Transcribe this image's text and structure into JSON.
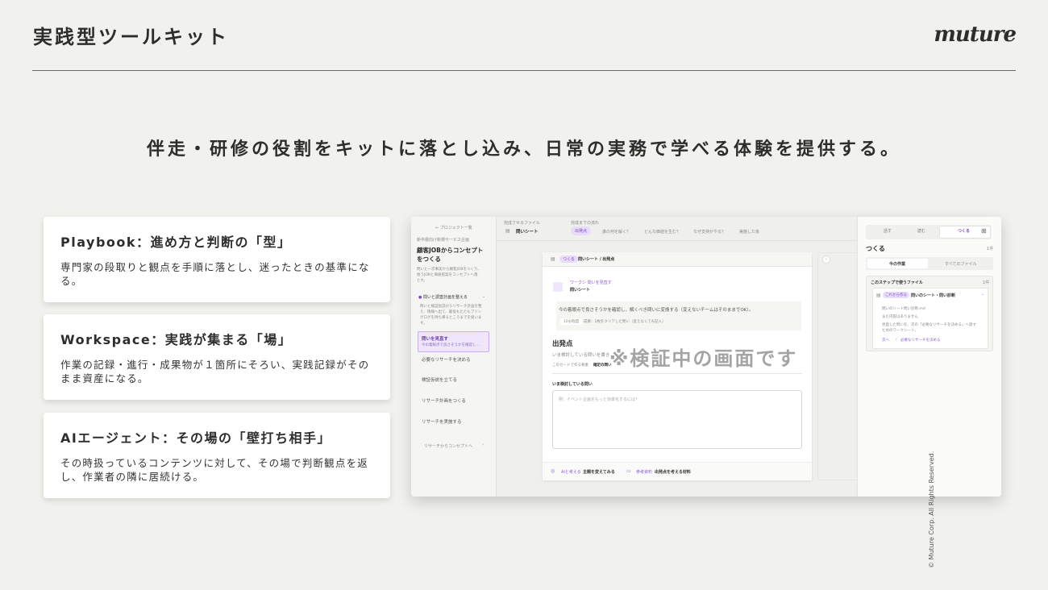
{
  "header": {
    "title": "実践型ツールキット",
    "logo_text": "muture"
  },
  "headline": "伴走・研修の役割をキットに落とし込み、日常の実務で学べる体験を提供する。",
  "cards": [
    {
      "title": "Playbook：進め方と判断の「型」",
      "body": "専門家の段取りと観点を手順に落とし、迷ったときの基準になる。"
    },
    {
      "title": "Workspace：実践が集まる「場」",
      "body": "作業の記録・進行・成果物が１箇所にそろい、実践記録がそのまま資産になる。"
    },
    {
      "title": "AIエージェント：その場の「壁打ち相手」",
      "body": "その時扱っているコンテンツに対して、その場で判断観点を返し、作業者の隣に居続ける。"
    }
  ],
  "copyright": "© Muture Corp. All Rights Reserved.",
  "mockup": {
    "watermark": "※検証中の画面です",
    "sidebar": {
      "back": "← プロジェクト一覧",
      "category": "新卒層向け新規サービス企画",
      "project_title_1": "顧客JOBからコンセプト",
      "project_title_2": "をつくる",
      "desc_1": "問いと一次事実から顧客JOBをつくり、",
      "desc_2": "拾うJOBと価値提案をコンセプトへ落",
      "desc_3": "とす。",
      "section": "問いと調査計画を整える",
      "section_desc_1": "問いと検証仮説からリサーチ計画を整",
      "section_desc_2": "え、情報へ出て、最低もたたもプリン",
      "section_desc_3": "グログを持ち帰るところまでを扱いま",
      "section_desc_4": "す。",
      "active_item": "問いを見直す",
      "active_sub": "今の着眼点で良さそうかを確認し…",
      "items": [
        "必要なリサーチを決める",
        "検証仮説を立てる",
        "リサーチ計画をつくる",
        "リサーチを実施する"
      ],
      "next": "リサーチからコンセプトへ"
    },
    "main": {
      "file_label": "完成させるファイル",
      "file_name": "問いシート",
      "flow_label": "完成までの流れ",
      "flow_current": "出発点",
      "flow_steps": [
        "誰の何を解く？",
        "どんな価値を生む？",
        "なぜ支持がやる？",
        "実施した後"
      ],
      "doc_tab": "つくる",
      "doc_title": "問いシート / 出発点",
      "doc_tag": "ワークシ 問いを見直す",
      "doc_name": "問いシート",
      "question": "今の着眼点で良さそうかを確認し、解くべき問いに変換する（変えないチームはそのままでOK）。",
      "chip_1": "10分程度",
      "chip_2": "成果：1枚をクリアした問い（変えなくても記入）",
      "section_title": "出発点",
      "section_desc": "いま検討している問いを書き",
      "card_note": "このカードで作る要素",
      "card_note_value": "確定の問い",
      "field_label": "いま検討している問い",
      "placeholder": "例：イベント企画をもっと効率化するには？",
      "foot_1_tag": "AIと考える",
      "foot_1": "主題を変えてみる",
      "foot_2_tag": "参考資料",
      "foot_2": "出発点を考える材料"
    },
    "right": {
      "tabs": [
        "話す",
        "読む",
        "つくる"
      ],
      "title": "つくる",
      "count": "1件",
      "seg": [
        "今の作業",
        "すべてのファイル"
      ],
      "box_title": "このステップで使うファイル",
      "box_count": "1件",
      "file_tag": "これから作る",
      "file_name": "問いのシート・問い診断",
      "line_1": "問いのシート問い診断.md",
      "line_2": "まだ内容はありません",
      "line_3": "見直した問いを、次の「必要なリサーチを決める」へ渡す",
      "line_4": "ためのワークシート。",
      "next_label": "次へ",
      "next_target": "必要なリサーチを決める"
    }
  }
}
